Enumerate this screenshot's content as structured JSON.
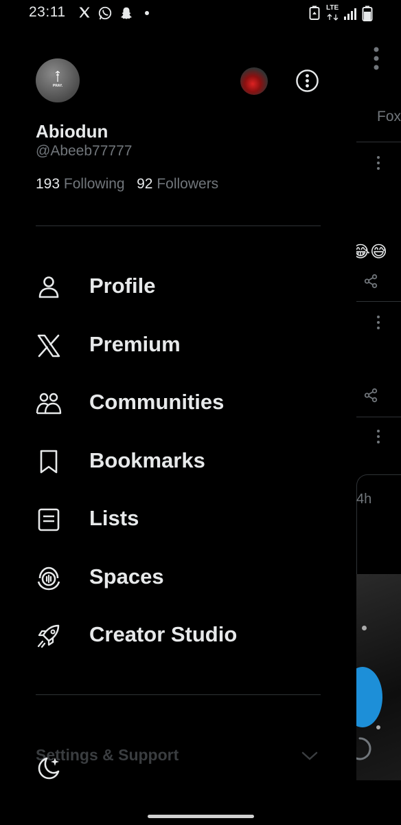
{
  "status_bar": {
    "time": "23:11",
    "network": "LTE",
    "notification_icons": [
      "x-icon",
      "whatsapp-icon",
      "snapchat-icon"
    ]
  },
  "drawer": {
    "avatar_text": "PRAY.",
    "name": "Abiodun",
    "handle": "@Abeeb77777",
    "following_count": "193",
    "following_label": "Following",
    "followers_count": "92",
    "followers_label": "Followers"
  },
  "menu": {
    "items": [
      {
        "label": "Profile",
        "icon": "person-icon"
      },
      {
        "label": "Premium",
        "icon": "x-logo-icon"
      },
      {
        "label": "Communities",
        "icon": "communities-icon"
      },
      {
        "label": "Bookmarks",
        "icon": "bookmark-icon"
      },
      {
        "label": "Lists",
        "icon": "list-icon"
      },
      {
        "label": "Spaces",
        "icon": "spaces-icon"
      },
      {
        "label": "Creator Studio",
        "icon": "rocket-icon"
      }
    ]
  },
  "settings": {
    "label": "Settings & Support"
  },
  "background": {
    "tab_fragment": "Fox",
    "time_fragment": "4h"
  },
  "colors": {
    "background": "#000000",
    "text_primary": "#e7e9ea",
    "text_secondary": "#71767b",
    "divider": "#2f3336",
    "accent": "#1d9bf0"
  }
}
